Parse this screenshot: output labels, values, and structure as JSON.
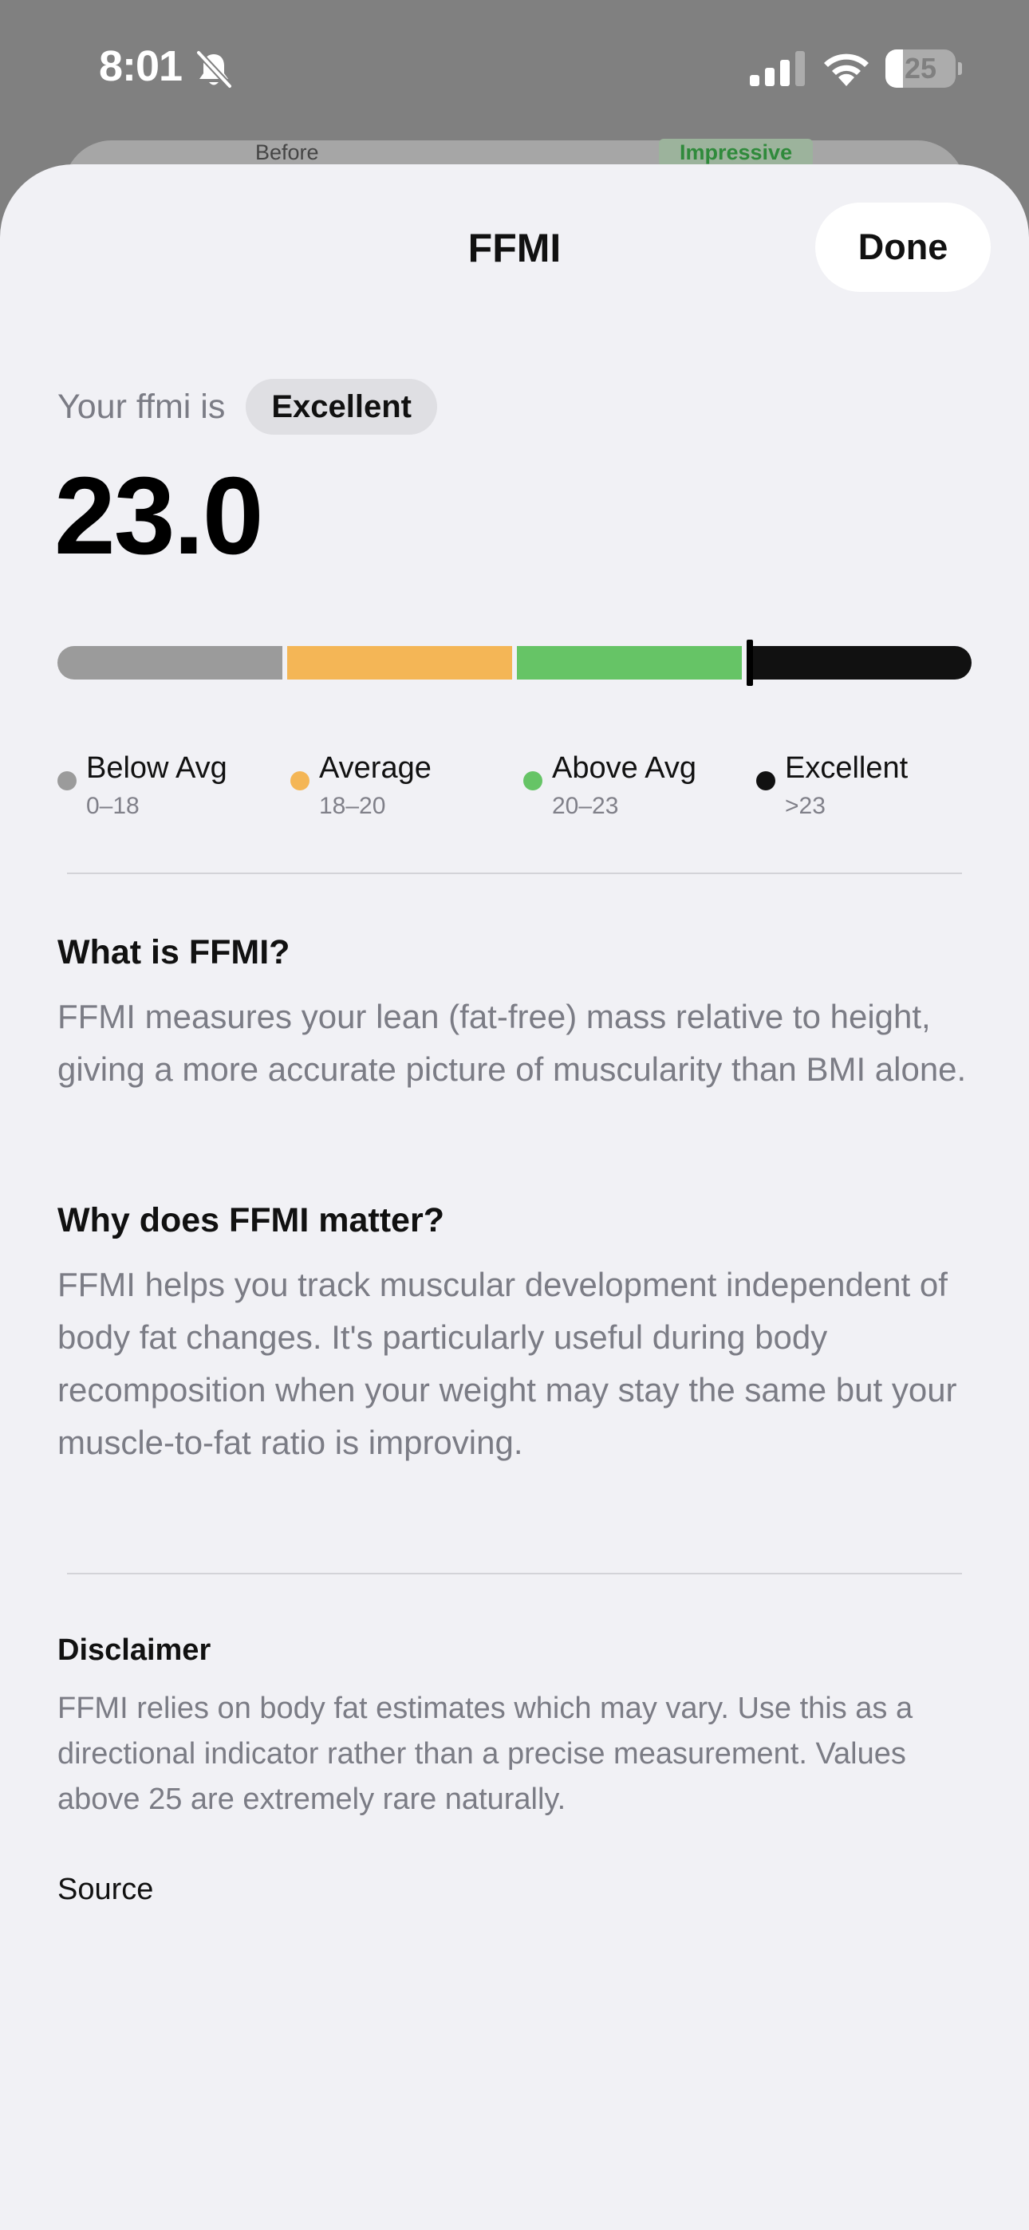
{
  "status_bar": {
    "time": "8:01",
    "battery_level": "25",
    "battery_fraction": 0.25
  },
  "background": {
    "before_label": "Before",
    "impressive_label": "Impressive"
  },
  "sheet": {
    "title": "FFMI",
    "done_label": "Done"
  },
  "result": {
    "intro": "Your ffmi is",
    "rating": "Excellent",
    "value": "23.0",
    "marker_value": 23.0
  },
  "scale": {
    "min": 14,
    "max": 26,
    "segments": [
      {
        "name": "Below Avg",
        "range": "0–18",
        "from": 14,
        "to": 18,
        "color": "#9b9b9b"
      },
      {
        "name": "Average",
        "range": "18–20",
        "from": 18,
        "to": 20,
        "color": "#f4b656"
      },
      {
        "name": "Above Avg",
        "range": "20–23",
        "from": 20,
        "to": 23,
        "color": "#66c466"
      },
      {
        "name": "Excellent",
        "range": ">23",
        "from": 23,
        "to": 26,
        "color": "#111111"
      }
    ]
  },
  "legend": [
    {
      "name": "Below Avg",
      "range": "0–18",
      "color": "#9b9b9b"
    },
    {
      "name": "Average",
      "range": "18–20",
      "color": "#f4b656"
    },
    {
      "name": "Above Avg",
      "range": "20–23",
      "color": "#66c466"
    },
    {
      "name": "Excellent",
      "range": ">23",
      "color": "#111111"
    }
  ],
  "what": {
    "heading": "What is FFMI?",
    "body": "FFMI measures your lean (fat-free) mass relative to height, giving a more accurate picture of muscularity than BMI alone."
  },
  "why": {
    "heading": "Why does FFMI matter?",
    "body": "FFMI helps you track muscular development independent of body fat changes. It's particularly useful during body recomposition when your weight may stay the same but your muscle-to-fat ratio is improving."
  },
  "disclaimer": {
    "heading": "Disclaimer",
    "body": "FFMI relies on body fat estimates which may vary. Use this as a directional indicator rather than a precise measurement. Values above 25 are extremely rare naturally."
  },
  "source": {
    "label": "Source"
  },
  "icons": {
    "bell_off": "bell-off-icon",
    "signal": "cellular-signal-icon",
    "wifi": "wifi-icon",
    "battery": "battery-icon"
  }
}
